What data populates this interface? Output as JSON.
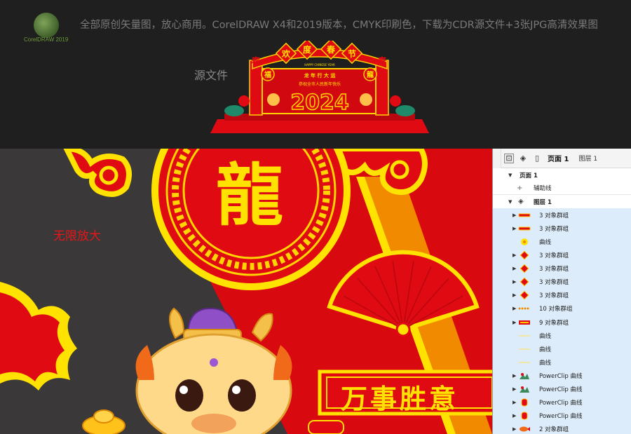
{
  "banner": {
    "logo_text": "CorelDRAW 2019",
    "headline": "全部原创矢量图，放心商用。CorelDRAW X4和2019版本，CMYK印刷色，下载为CDR源文件+3张JPG高清效果图",
    "source_label": "源文件",
    "preview": {
      "arch_chars": [
        "欢",
        "度",
        "春",
        "节"
      ],
      "corner_chars": [
        "福",
        "龍"
      ],
      "side_chars": [
        "春",
        "春"
      ],
      "sub_text": "龙 年 行 大 运",
      "tiny_text": "HAPPY CHINESE YEAR",
      "year": "2024",
      "bottom_text": "恭祝全市人民新年快乐"
    }
  },
  "canvas": {
    "zoom_label": "无限放大",
    "medallion_char": "龍",
    "ribbon_text": "万事胜意"
  },
  "panel": {
    "toolbar": {
      "page_title": "页面 1",
      "layer_title": "图层 1"
    },
    "page_row": "页面 1",
    "guides_row": "辅助线",
    "layer_row": "图层 1",
    "items": [
      {
        "label": "3 对象群组",
        "thumb": "bar",
        "expand": true
      },
      {
        "label": "3 对象群组",
        "thumb": "bar",
        "expand": true
      },
      {
        "label": "曲线",
        "thumb": "flower",
        "expand": false
      },
      {
        "label": "3 对象群组",
        "thumb": "diamond",
        "expand": true
      },
      {
        "label": "3 对象群组",
        "thumb": "diamond",
        "expand": true
      },
      {
        "label": "3 对象群组",
        "thumb": "diamond",
        "expand": true
      },
      {
        "label": "3 对象群组",
        "thumb": "diamond",
        "expand": true
      },
      {
        "label": "10 对象群组",
        "thumb": "dots",
        "expand": true
      },
      {
        "label": "9 对象群组",
        "thumb": "year",
        "expand": true
      },
      {
        "label": "曲线",
        "thumb": "line",
        "expand": false
      },
      {
        "label": "曲线",
        "thumb": "line",
        "expand": false
      },
      {
        "label": "曲线",
        "thumb": "line",
        "expand": false
      },
      {
        "label": "PowerClip 曲线",
        "thumb": "mount",
        "expand": true
      },
      {
        "label": "PowerClip 曲线",
        "thumb": "mount",
        "expand": true
      },
      {
        "label": "PowerClip 曲线",
        "thumb": "lantern",
        "expand": true
      },
      {
        "label": "PowerClip 曲线",
        "thumb": "lantern",
        "expand": true
      },
      {
        "label": "2 对象群组",
        "thumb": "fish",
        "expand": true
      }
    ]
  },
  "colors": {
    "festive_red": "#e00a12",
    "gold": "#ffe200",
    "orange": "#f28a00",
    "selection": "#dcecfa"
  }
}
